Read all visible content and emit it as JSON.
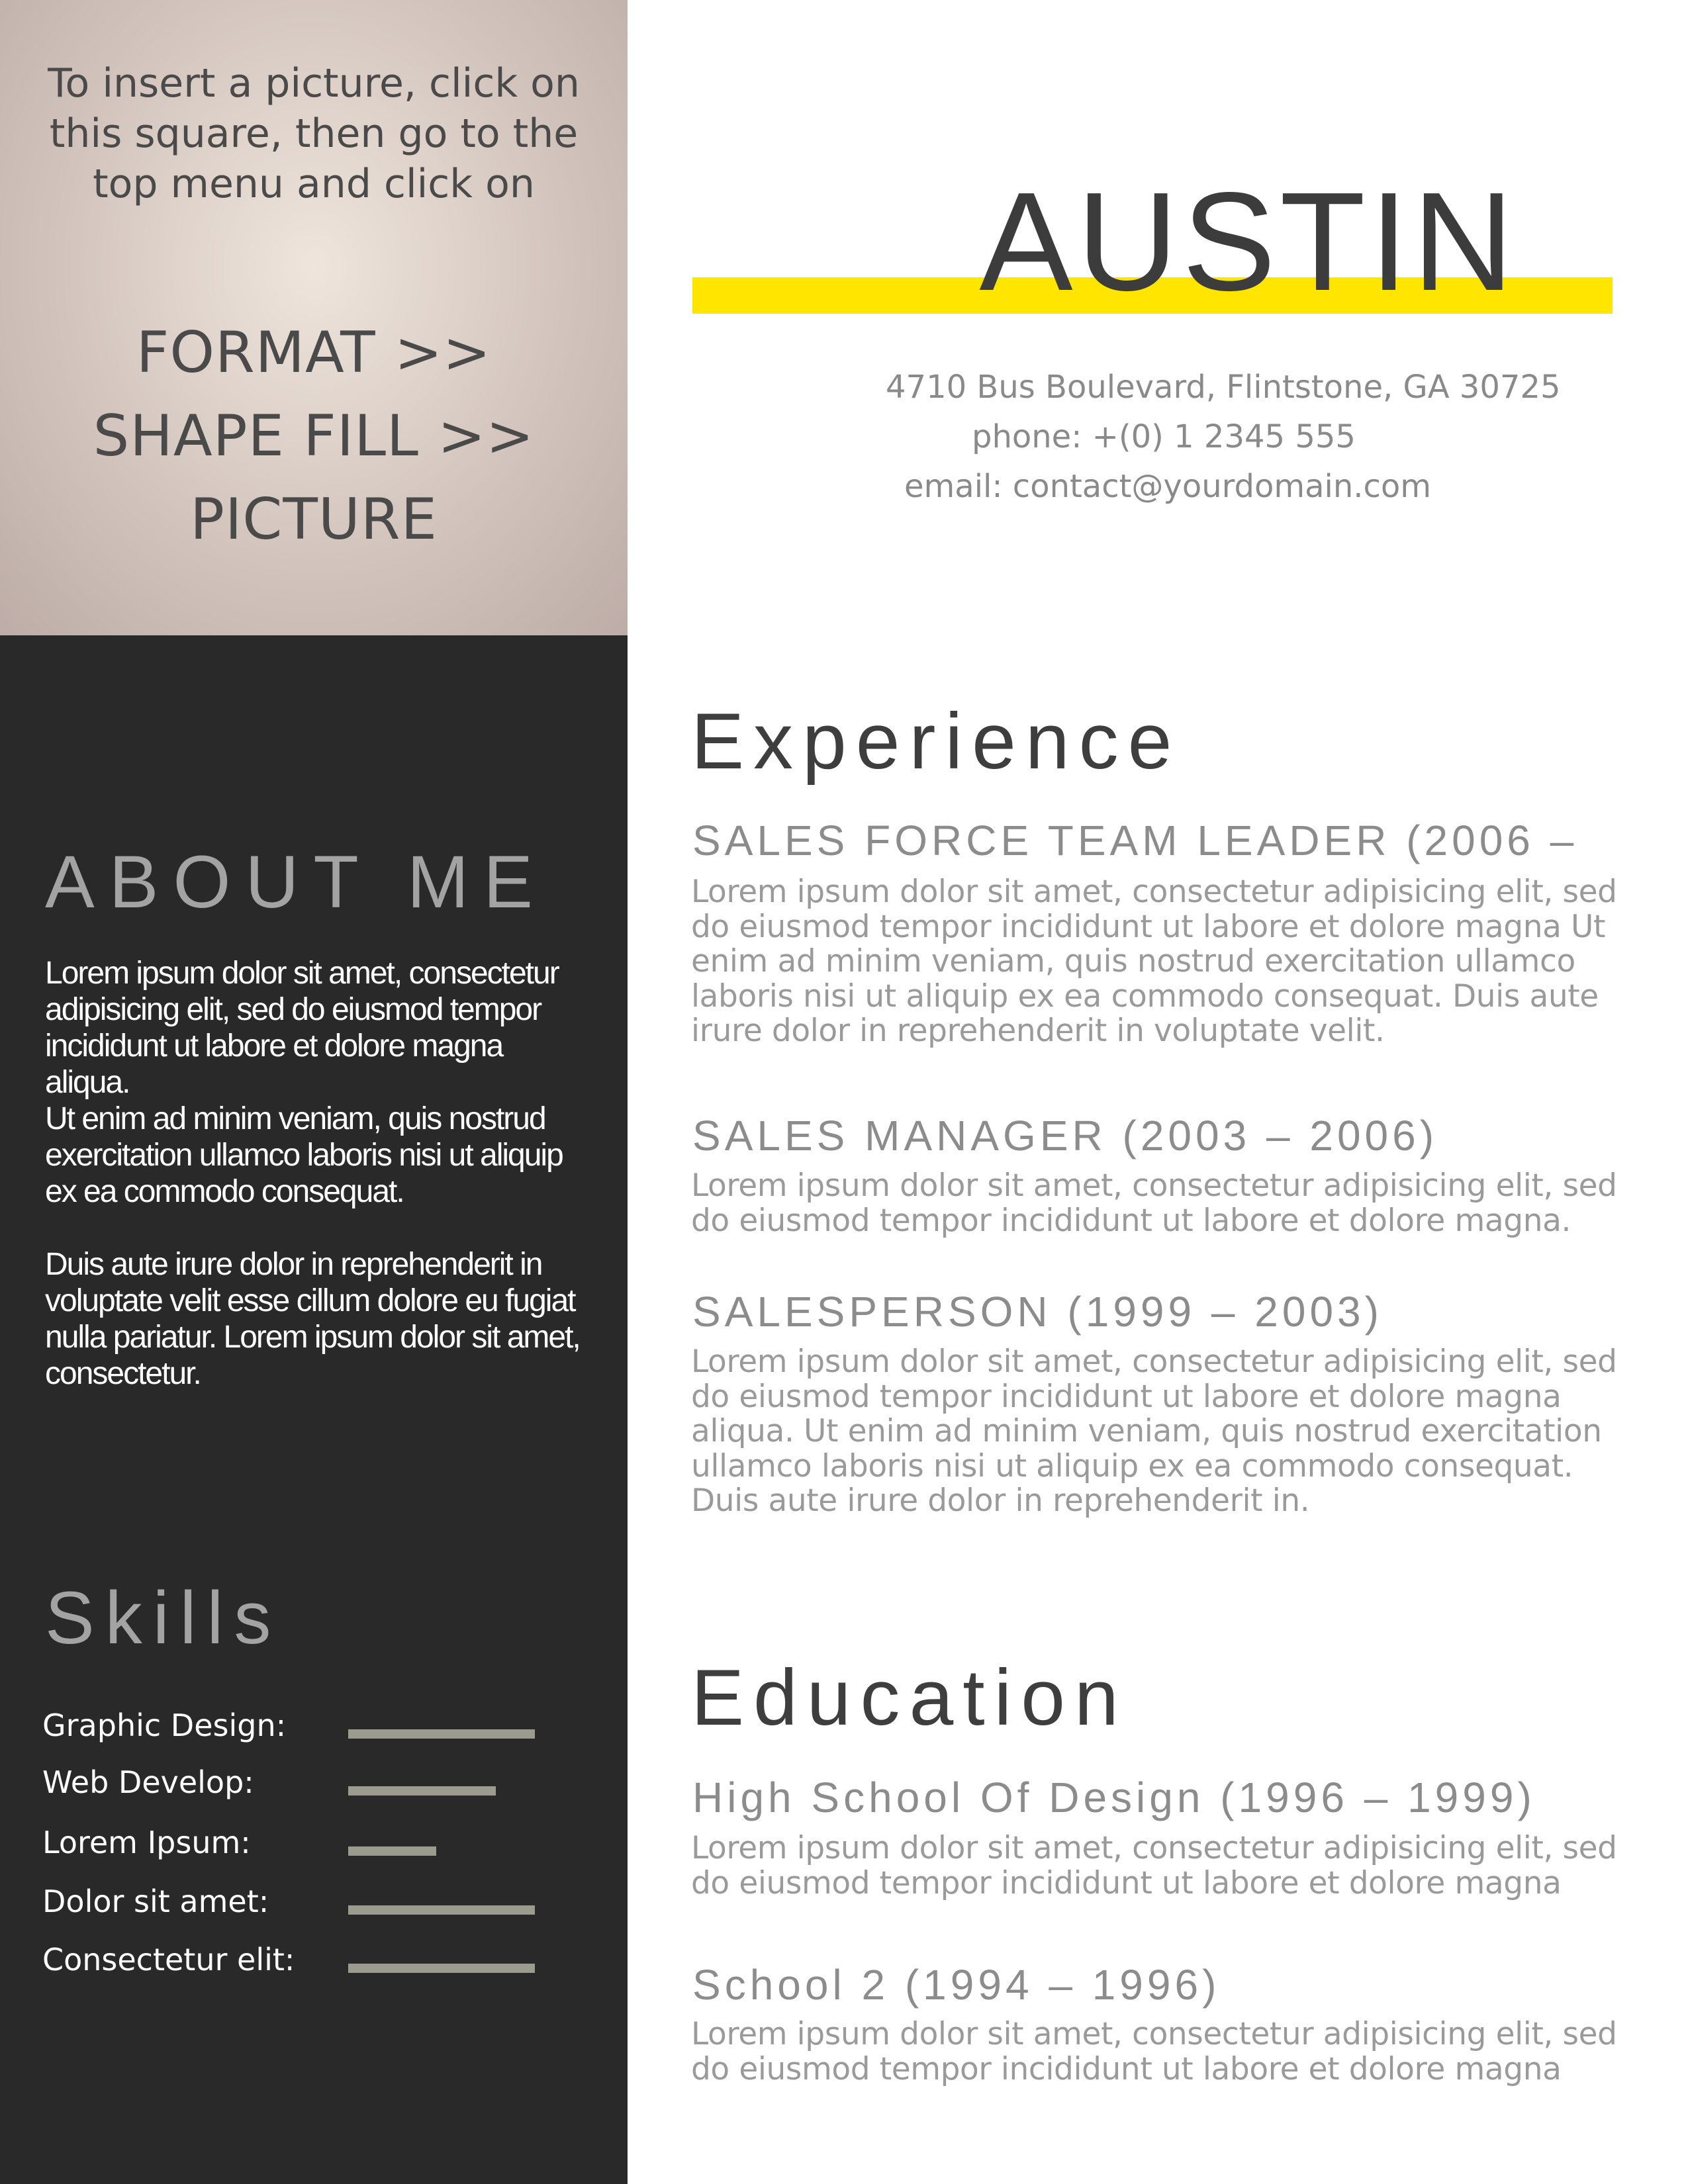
{
  "photo_placeholder": {
    "instructions": "To insert a picture, click on this square, then go to the top menu and click on",
    "step1": "FORMAT >>",
    "step2": "SHAPE FILL >>",
    "step3": "PICTURE"
  },
  "header": {
    "name": "AUSTIN",
    "address": "4710 Bus Boulevard, Flintstone, GA 30725",
    "phone": "phone: +(0) 1 2345 555",
    "email": "email: contact@yourdomain.com",
    "accent_color": "#ffe500"
  },
  "about": {
    "heading": "ABOUT ME",
    "para1": "Lorem ipsum dolor sit amet, consectetur adipisicing elit, sed do eiusmod tempor incididunt ut labore et dolore magna aliqua.",
    "para2": "Ut enim ad minim veniam, quis nostrud exercitation ullamco laboris nisi ut aliquip ex ea commodo consequat.",
    "para3": "Duis aute irure dolor in reprehenderit in voluptate velit esse cillum dolore eu fugiat nulla pariatur. Lorem ipsum dolor sit amet, consectetur."
  },
  "skills": {
    "heading": "Skills",
    "items": [
      {
        "label": "Graphic Design:",
        "level": 1.0
      },
      {
        "label": "Web Develop:",
        "level": 0.79
      },
      {
        "label": "Lorem Ipsum:",
        "level": 0.47
      },
      {
        "label": "Dolor sit amet:",
        "level": 1.0
      },
      {
        "label": "Consectetur elit:",
        "level": 1.0
      }
    ]
  },
  "experience": {
    "heading": "Experience",
    "entries": [
      {
        "title": "SALES FORCE TEAM LEADER (2006 –",
        "body": "Lorem ipsum dolor sit amet, consectetur adipisicing elit, sed do eiusmod tempor incididunt ut labore et dolore magna Ut enim ad minim veniam, quis nostrud exercitation ullamco laboris nisi ut aliquip ex ea commodo consequat. Duis aute irure dolor in reprehenderit in voluptate velit."
      },
      {
        "title": "SALES MANAGER (2003 – 2006)",
        "body": "Lorem ipsum dolor sit amet, consectetur adipisicing elit, sed do eiusmod tempor incididunt ut labore et dolore magna."
      },
      {
        "title": "SALESPERSON (1999 – 2003)",
        "body": "Lorem ipsum dolor sit amet, consectetur adipisicing elit, sed do eiusmod tempor incididunt ut labore et dolore magna aliqua. Ut enim ad minim veniam, quis nostrud exercitation ullamco laboris nisi ut aliquip ex ea commodo consequat. Duis aute irure dolor in reprehenderit in."
      }
    ]
  },
  "education": {
    "heading": "Education",
    "entries": [
      {
        "title": "High School Of Design (1996 – 1999)",
        "body": "Lorem ipsum dolor sit amet, consectetur adipisicing elit, sed do eiusmod tempor incididunt ut labore et dolore magna"
      },
      {
        "title": "School 2 (1994 – 1996)",
        "body": "Lorem ipsum dolor sit amet, consectetur adipisicing elit, sed do eiusmod tempor incididunt ut labore et dolore magna"
      }
    ]
  }
}
